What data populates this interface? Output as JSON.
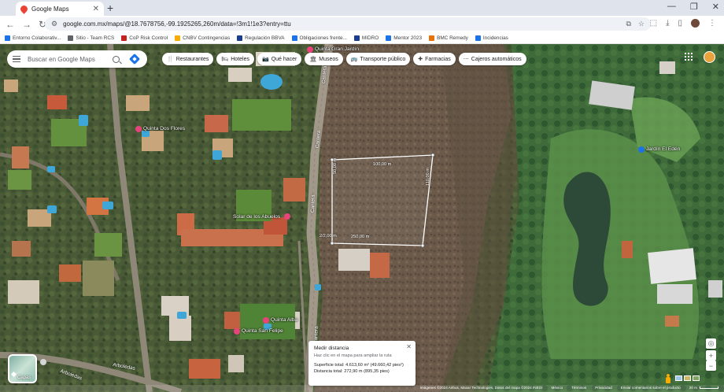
{
  "browser": {
    "tab_title": "Google Maps",
    "close_tab": "✕",
    "new_tab": "+",
    "window_controls": [
      "—",
      "❐",
      "✕"
    ],
    "url": "google.com.mx/maps/@18.7678756,-99.1925265,260m/data=!3m1!1e3?entry=ttu",
    "bookmarks": [
      {
        "label": "Entorno Colaborativ...",
        "color": "#1a73e8"
      },
      {
        "label": "Sitio - Team RCS",
        "color": "#5f6368"
      },
      {
        "label": "CoP Risk Control",
        "color": "#c5221f"
      },
      {
        "label": "CNBV Contingencias",
        "color": "#f9ab00"
      },
      {
        "label": "Regulación BBVA",
        "color": "#1a3d8f"
      },
      {
        "label": "Obligaciones frente...",
        "color": "#1a73e8"
      },
      {
        "label": "MIDRO",
        "color": "#1a3d8f"
      },
      {
        "label": "Mentor 2023",
        "color": "#1a73e8"
      },
      {
        "label": "BMC Remedy",
        "color": "#e8710a"
      },
      {
        "label": "Incidencias",
        "color": "#1a73e8"
      }
    ]
  },
  "search": {
    "placeholder": "Buscar en Google Maps"
  },
  "chips": [
    {
      "label": "Restaurantes",
      "icon": "🍴",
      "name": "chip-restaurantes"
    },
    {
      "label": "Hoteles",
      "icon": "🛏",
      "name": "chip-hoteles"
    },
    {
      "label": "Qué hacer",
      "icon": "📷",
      "name": "chip-que-hacer"
    },
    {
      "label": "Museos",
      "icon": "🏛",
      "name": "chip-museos"
    },
    {
      "label": "Transporte público",
      "icon": "🚌",
      "name": "chip-transporte-publico"
    },
    {
      "label": "Farmacias",
      "icon": "✚",
      "name": "chip-farmacias"
    },
    {
      "label": "Cajeros automáticos",
      "icon": "⋯",
      "name": "chip-cajeros-automaticos"
    }
  ],
  "map_labels": {
    "quinta_jardin": "Quinta Gran Jardín",
    "quinta_dos_flores": "Quinta Dos Flores",
    "solar_abuelos": "Solar de los Abuelos",
    "jardin_eden": "Jardín El Edén",
    "quinta_alba": "Quinta Alba",
    "quinta_san_felipe": "Quinta San Felipe",
    "road_cantera_1": "Cantera",
    "road_cantera_2": "Cantera",
    "road_cantera_3": "Cantera",
    "road_cantera_4": "Cantera",
    "road_arboledas_1": "Arboledas",
    "road_arboledas_2": "Arboledas"
  },
  "measurement": {
    "segments": {
      "top": "100,00 m",
      "left": "50,00 m",
      "right": "110,00 m",
      "bottom": "250,00 m",
      "corner": "2/2,00 m"
    },
    "title": "Medir distancia",
    "hint": "Haz clic en el mapa para ampliar la ruta",
    "area": "Superficie total: 4.613,60 m² (49.660,42 pies²)",
    "distance": "Distancia total: 272,90 m (895,35 pies)"
  },
  "layers_label": "Capas",
  "attribution": {
    "imagery": "Imágenes ©2024 Airbus, Maxar Technologies, Datos del mapa ©2024 INEGI",
    "links": [
      "México",
      "Términos",
      "Privacidad",
      "Enviar comentarios sobre el producto"
    ],
    "scale": "20 m"
  },
  "colors": {
    "accent": "#1a73e8",
    "measure_line": "#ffffff",
    "poi_pink": "#e8437a"
  }
}
